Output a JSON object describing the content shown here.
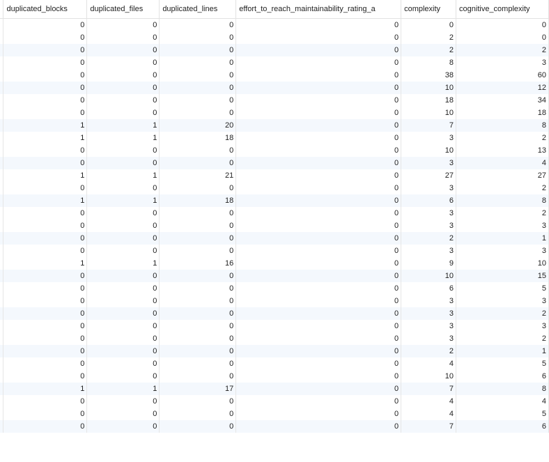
{
  "table": {
    "columns": [
      "duplicated_blocks",
      "duplicated_files",
      "duplicated_lines",
      "effort_to_reach_maintainability_rating_a",
      "complexity",
      "cognitive_complexity"
    ],
    "rows": [
      [
        "0",
        "0",
        "0",
        "0",
        "0",
        "0"
      ],
      [
        "0",
        "0",
        "0",
        "0",
        "2",
        "0"
      ],
      [
        "0",
        "0",
        "0",
        "0",
        "2",
        "2"
      ],
      [
        "0",
        "0",
        "0",
        "0",
        "8",
        "3"
      ],
      [
        "0",
        "0",
        "0",
        "0",
        "38",
        "60"
      ],
      [
        "0",
        "0",
        "0",
        "0",
        "10",
        "12"
      ],
      [
        "0",
        "0",
        "0",
        "0",
        "18",
        "34"
      ],
      [
        "0",
        "0",
        "0",
        "0",
        "10",
        "18"
      ],
      [
        "1",
        "1",
        "20",
        "0",
        "7",
        "8"
      ],
      [
        "1",
        "1",
        "18",
        "0",
        "3",
        "2"
      ],
      [
        "0",
        "0",
        "0",
        "0",
        "10",
        "13"
      ],
      [
        "0",
        "0",
        "0",
        "0",
        "3",
        "4"
      ],
      [
        "1",
        "1",
        "21",
        "0",
        "27",
        "27"
      ],
      [
        "0",
        "0",
        "0",
        "0",
        "3",
        "2"
      ],
      [
        "1",
        "1",
        "18",
        "0",
        "6",
        "8"
      ],
      [
        "0",
        "0",
        "0",
        "0",
        "3",
        "2"
      ],
      [
        "0",
        "0",
        "0",
        "0",
        "3",
        "3"
      ],
      [
        "0",
        "0",
        "0",
        "0",
        "2",
        "1"
      ],
      [
        "0",
        "0",
        "0",
        "0",
        "3",
        "3"
      ],
      [
        "1",
        "1",
        "16",
        "0",
        "9",
        "10"
      ],
      [
        "0",
        "0",
        "0",
        "0",
        "10",
        "15"
      ],
      [
        "0",
        "0",
        "0",
        "0",
        "6",
        "5"
      ],
      [
        "0",
        "0",
        "0",
        "0",
        "3",
        "3"
      ],
      [
        "0",
        "0",
        "0",
        "0",
        "3",
        "2"
      ],
      [
        "0",
        "0",
        "0",
        "0",
        "3",
        "3"
      ],
      [
        "0",
        "0",
        "0",
        "0",
        "3",
        "2"
      ],
      [
        "0",
        "0",
        "0",
        "0",
        "2",
        "1"
      ],
      [
        "0",
        "0",
        "0",
        "0",
        "4",
        "5"
      ],
      [
        "0",
        "0",
        "0",
        "0",
        "10",
        "6"
      ],
      [
        "1",
        "1",
        "17",
        "0",
        "7",
        "8"
      ],
      [
        "0",
        "0",
        "0",
        "0",
        "4",
        "4"
      ],
      [
        "0",
        "0",
        "0",
        "0",
        "4",
        "5"
      ],
      [
        "0",
        "0",
        "0",
        "0",
        "7",
        "6"
      ]
    ],
    "alt_rows": [
      2,
      5,
      8,
      11,
      14,
      17,
      20,
      23,
      26,
      29,
      32
    ]
  }
}
